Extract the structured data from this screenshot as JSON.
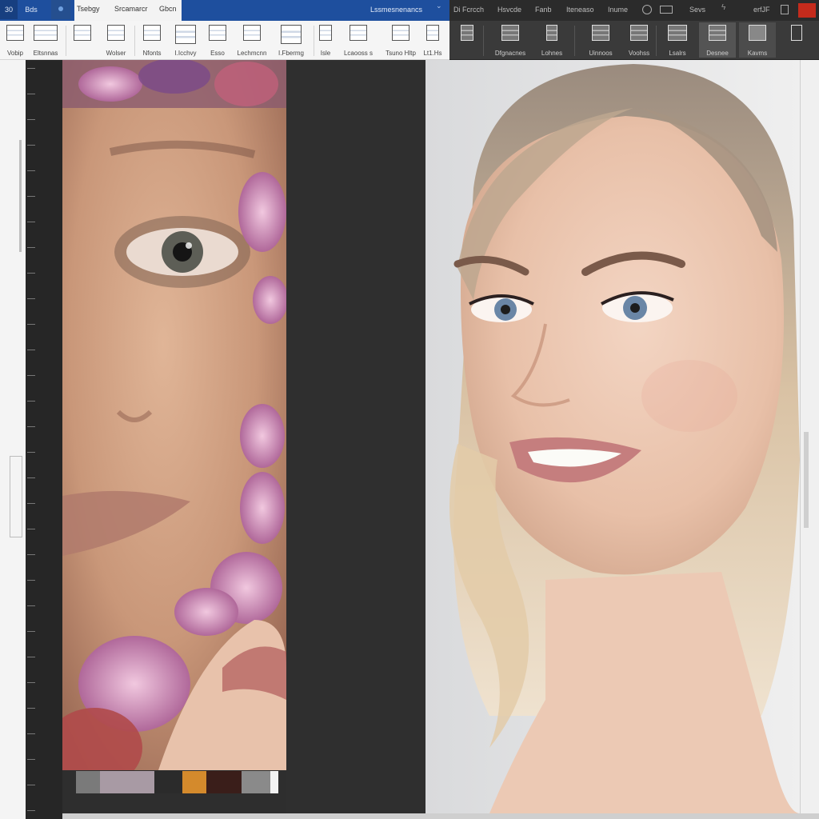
{
  "window": {
    "quick_access": [
      "30",
      "Bds"
    ],
    "tabs": [
      "Tsebgy",
      "Srcamarcr",
      "Gbcn"
    ],
    "document_title": "Lssmesnenancs",
    "dark_tabs": [
      "Di Fcrcch",
      "Hsvcde",
      "Fanb",
      "Iteneaso",
      "Inume",
      "Sevs",
      "erfJF"
    ]
  },
  "ribbon_light": {
    "labels": [
      "Vobip",
      "Eltsnnas",
      "Wolser",
      "Nfonts",
      "I.Icchvy",
      "Esso",
      "Lechmcnn",
      "I.Fbermg",
      "Isle",
      "Lcaooss s",
      "Tsuno Hltp",
      "Lt1.Hs"
    ]
  },
  "ribbon_dark": {
    "labels": [
      "Dfgnacnes",
      "Lohnes",
      "Uinnoos",
      "Voohss",
      "Lsalrs",
      "Desnee",
      "Kavms"
    ]
  },
  "colors": {
    "title_bar": "#1e4f9e",
    "ribbon_light": "#f5f5f5",
    "ribbon_dark": "#3a3a3a",
    "canvas_bg": "#2e2e2e",
    "close_button": "#c42b1c"
  },
  "swatches": [
    "#7a7a7a",
    "#a89aa4",
    "#2b2b2b",
    "#d48a2c",
    "#3a1e1a",
    "#8a8a8a",
    "#f2f2f2"
  ]
}
